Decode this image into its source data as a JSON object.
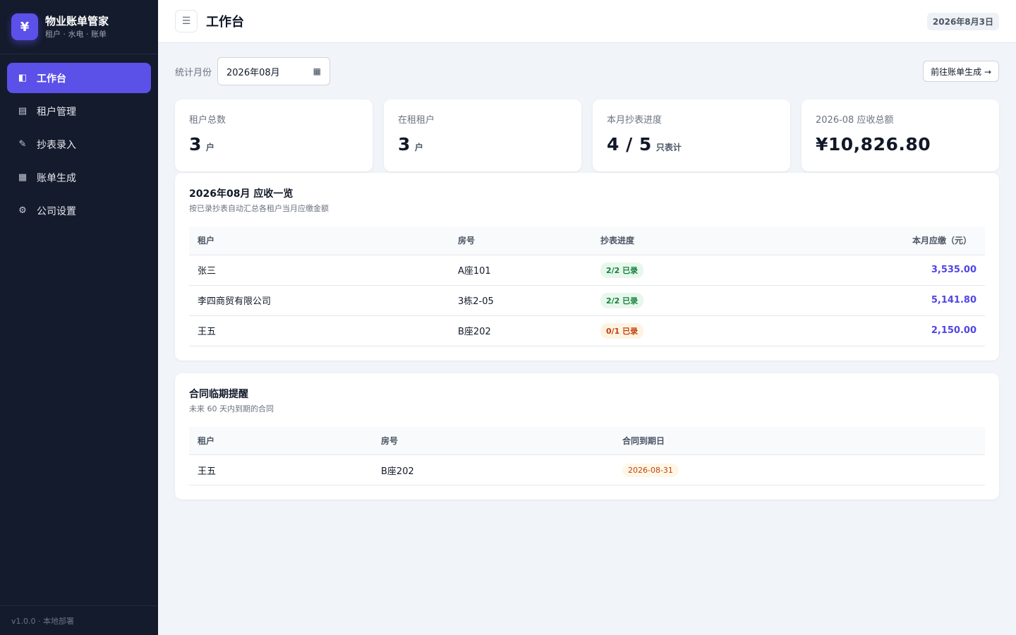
{
  "app": {
    "logo_symbol": "¥",
    "title": "物业账单管家",
    "subtitle": "租户 · 水电 · 账单",
    "version": "v1.0.0 · 本地部署"
  },
  "sidebar": {
    "items": [
      {
        "icon": "dashboard-icon",
        "glyph": "◧",
        "label": "工作台",
        "active": true
      },
      {
        "icon": "list-icon",
        "glyph": "▤",
        "label": "租户管理",
        "active": false
      },
      {
        "icon": "pencil-icon",
        "glyph": "✎",
        "label": "抄表录入",
        "active": false
      },
      {
        "icon": "grid-icon",
        "glyph": "▦",
        "label": "账单生成",
        "active": false
      },
      {
        "icon": "gear-icon",
        "glyph": "⚙",
        "label": "公司设置",
        "active": false
      }
    ]
  },
  "header": {
    "menu_glyph": "☰",
    "title": "工作台",
    "date": "2026年8月3日"
  },
  "toolbar": {
    "month_label": "统计月份",
    "month_value": "2026年08月",
    "calendar_glyph": "▦",
    "goto_label": "前往账单生成 →"
  },
  "stats": [
    {
      "label": "租户总数",
      "value": "3",
      "unit": "户"
    },
    {
      "label": "在租租户",
      "value": "3",
      "unit": "户"
    },
    {
      "label": "本月抄表进度",
      "value": "4 / 5",
      "unit": "只表计"
    },
    {
      "label": "2026-08 应收总额",
      "value": "¥10,826.80",
      "unit": ""
    }
  ],
  "receivables": {
    "title": "2026年08月 应收一览",
    "subtitle": "按已录抄表自动汇总各租户当月应缴金额",
    "columns": [
      "租户",
      "房号",
      "抄表进度",
      "本月应缴（元）"
    ],
    "rows": [
      {
        "tenant": "张三",
        "room": "A座101",
        "progress": "2/2 已录",
        "status": "green",
        "amount": "3,535.00"
      },
      {
        "tenant": "李四商贸有限公司",
        "room": "3栋2-05",
        "progress": "2/2 已录",
        "status": "green",
        "amount": "5,141.80"
      },
      {
        "tenant": "王五",
        "room": "B座202",
        "progress": "0/1 已录",
        "status": "orange",
        "amount": "2,150.00"
      }
    ]
  },
  "contracts": {
    "title": "合同临期提醒",
    "subtitle": "未来 60 天内到期的合同",
    "columns": [
      "租户",
      "房号",
      "合同到期日"
    ],
    "rows": [
      {
        "tenant": "王五",
        "room": "B座202",
        "due": "2026-08-31"
      }
    ]
  },
  "colors": {
    "accent": "#5b50e8",
    "sidebar_bg": "#141b2d",
    "amount": "#4f46e5",
    "ok": "#15803d",
    "warn": "#c2410c"
  }
}
